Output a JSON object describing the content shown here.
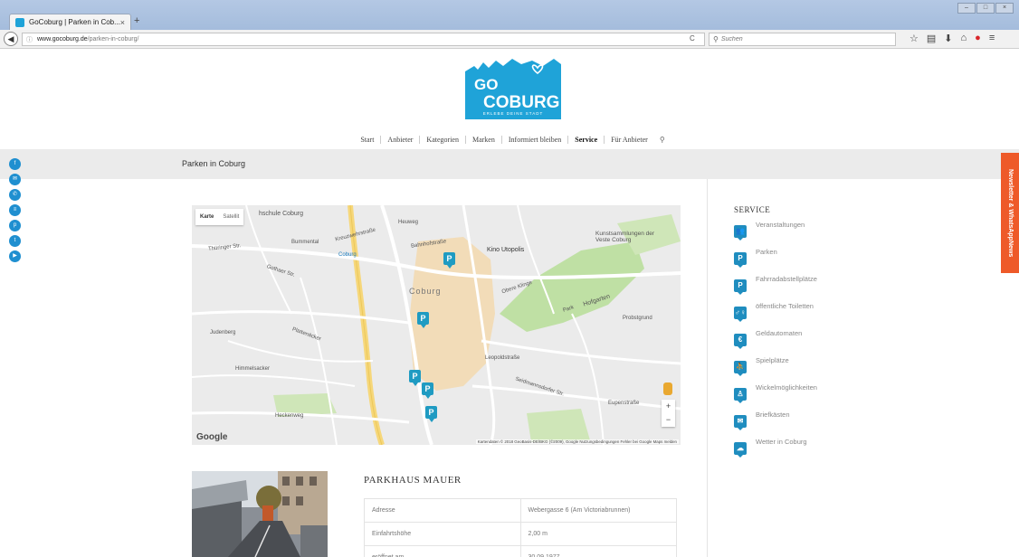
{
  "browser": {
    "tab_title": "GoCoburg | Parken in Cob...",
    "url_host": "www.gocoburg.de",
    "url_path": "/parken-in-coburg/",
    "search_placeholder": "Suchen"
  },
  "logo": {
    "line1": "GO",
    "line2": "COBURG",
    "tagline": "ERLEBE DEINE STADT",
    "color": "#1fa3d8"
  },
  "nav": {
    "items": [
      "Start",
      "Anbieter",
      "Kategorien",
      "Marken",
      "Informiert bleiben",
      "Service",
      "Für Anbieter"
    ],
    "active": "Service"
  },
  "page": {
    "title": "Parken in Coburg",
    "newsletter_tab": "Newsletter & WhatsAppNews"
  },
  "map": {
    "type_map": "Karte",
    "type_satellite": "Satellit",
    "labels": [
      "hschule Coburg",
      "Heuweg",
      "Kreuzwehrstraße",
      "Bahnhofstraße",
      "Kino Utopolis",
      "Kunstsammlungen der Veste Coburg",
      "Thüringer Str.",
      "Bummental",
      "Gothaer Str.",
      "Coburg",
      "Coburg",
      "Obere Klinge",
      "Hofgarten",
      "Judenberg",
      "Plattenäcker",
      "Leopoldstraße",
      "Himmelsacker",
      "Seidmannsdorfer Str.",
      "Eupenstraße",
      "Heckenweg",
      "Probstgrund",
      "Park"
    ],
    "google": "Google",
    "attribution": "Kartendaten © 2018 GeoBasis-DE/BKG (©2009), Google   Nutzungsbedingungen   Fehler bei Google Maps melden",
    "zoom_in": "+",
    "zoom_out": "−",
    "pin_label": "P"
  },
  "parkhaus": {
    "title": "PARKHAUS MAUER",
    "rows": [
      [
        "Adresse",
        "Webergasse 6 (Am Victoriabrunnen)"
      ],
      [
        "Einfahrtshöhe",
        "2,00 m"
      ],
      [
        "eröffnet am",
        "30.09.1977"
      ]
    ]
  },
  "sidebar": {
    "heading": "SERVICE",
    "items": [
      {
        "label": "Veranstaltungen",
        "icon": "people-icon",
        "glyph": "👥"
      },
      {
        "label": "Parken",
        "icon": "parking-icon",
        "glyph": "P"
      },
      {
        "label": "Fahrradabstellplätze",
        "icon": "bicycle-parking-icon",
        "glyph": "P"
      },
      {
        "label": "öffentliche Toiletten",
        "icon": "toilet-icon",
        "glyph": "♂♀"
      },
      {
        "label": "Geldautomaten",
        "icon": "euro-icon",
        "glyph": "€"
      },
      {
        "label": "Spielplätze",
        "icon": "playground-icon",
        "glyph": "⛹"
      },
      {
        "label": "Wickelmöglichkeiten",
        "icon": "baby-icon",
        "glyph": "♙"
      },
      {
        "label": "Briefkästen",
        "icon": "mailbox-icon",
        "glyph": "✉"
      },
      {
        "label": "Wetter in Coburg",
        "icon": "weather-icon",
        "glyph": "☁"
      }
    ]
  },
  "social": [
    "f",
    "✉",
    "✆",
    "≡",
    "p",
    "t",
    "▶"
  ]
}
